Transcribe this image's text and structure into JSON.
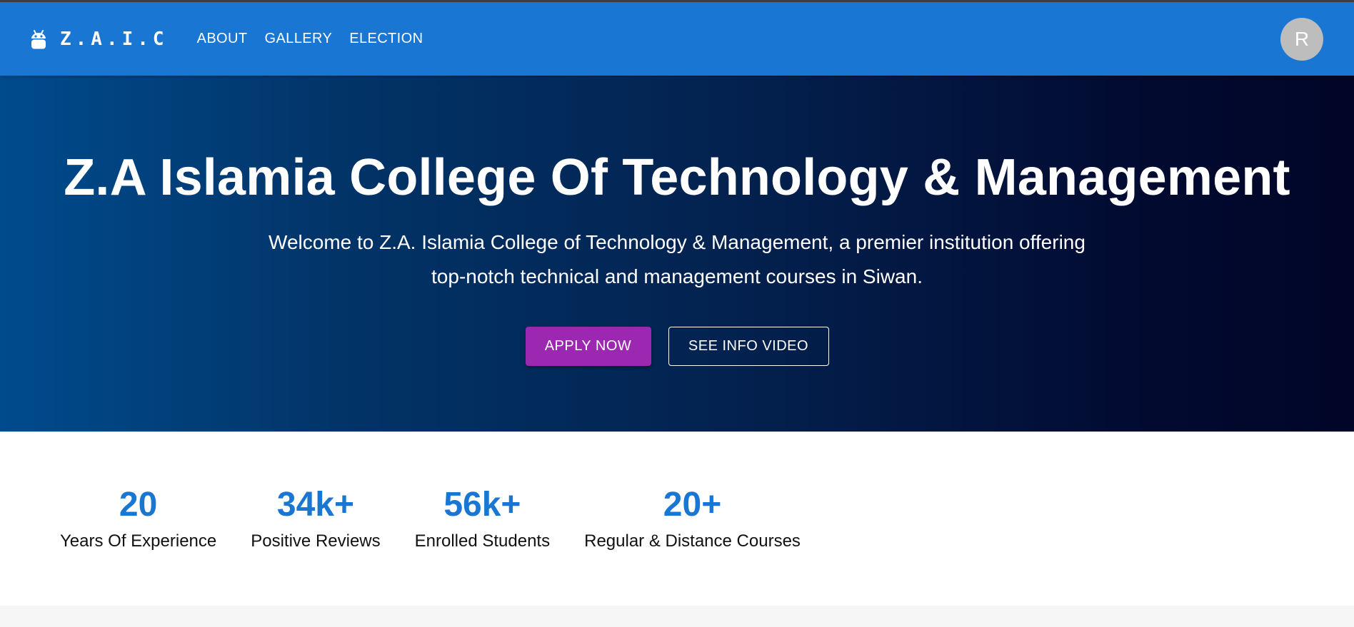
{
  "header": {
    "brand": "Z.A.I.C",
    "nav": [
      "ABOUT",
      "GALLERY",
      "ELECTION"
    ],
    "avatar_initial": "R",
    "brand_icon": "android-icon",
    "bar_color": "#1976d2"
  },
  "hero": {
    "title": "Z.A Islamia College Of Technology & Management",
    "description": "Welcome to Z.A. Islamia College of Technology & Management, a premier institution offering top-notch technical and management courses in Siwan.",
    "apply_label": "APPLY NOW",
    "video_label": "SEE INFO VIDEO",
    "apply_color": "#9c27b0"
  },
  "stats": [
    {
      "value": "20",
      "label": "Years Of Experience"
    },
    {
      "value": "34k+",
      "label": "Positive Reviews"
    },
    {
      "value": "56k+",
      "label": "Enrolled Students"
    },
    {
      "value": "20+",
      "label": "Regular & Distance Courses"
    }
  ]
}
